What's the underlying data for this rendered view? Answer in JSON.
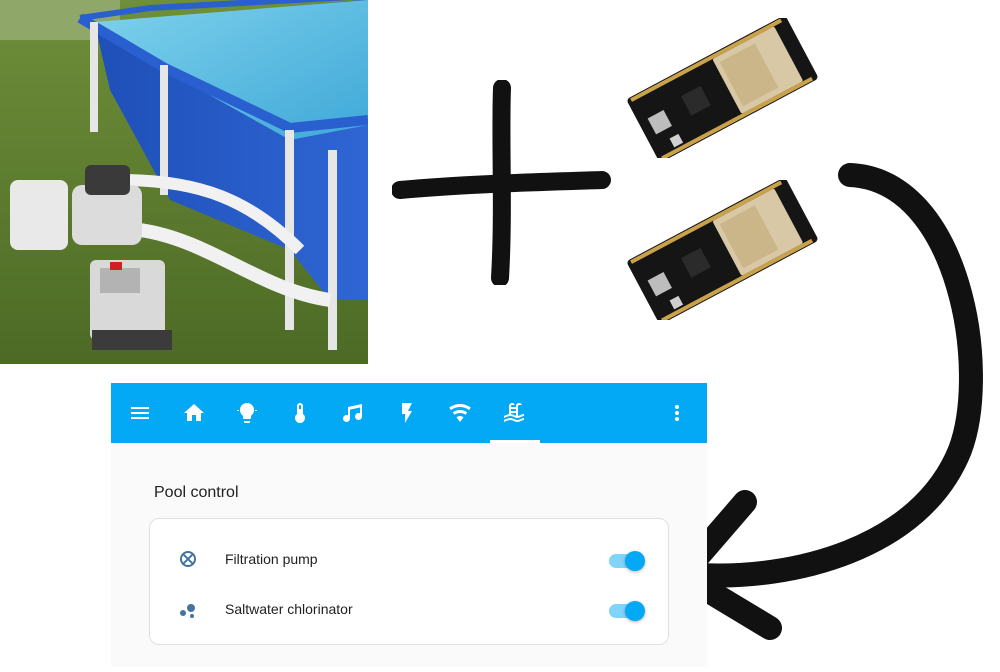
{
  "toolbar": {
    "icons": [
      "menu-icon",
      "home-icon",
      "lightbulb-icon",
      "thermometer-icon",
      "music-icon",
      "flash-icon",
      "wifi-icon",
      "pool-icon",
      "more-vert-icon"
    ],
    "active_tab": "pool-icon",
    "color": "#03a9f4"
  },
  "section": {
    "title": "Pool control"
  },
  "entities": [
    {
      "name": "Filtration pump",
      "icon": "pump-icon",
      "state": "on"
    },
    {
      "name": "Saltwater chlorinator",
      "icon": "chlorinator-icon",
      "state": "on"
    }
  ],
  "colors": {
    "accent": "#03a9f4",
    "entity_icon": "#44739e"
  }
}
